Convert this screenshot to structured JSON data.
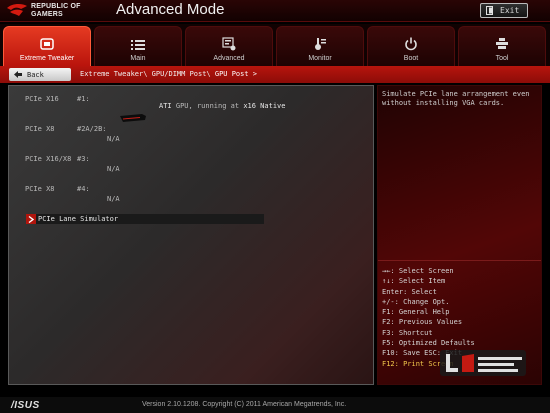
{
  "header": {
    "brand_line1": "REPUBLIC OF",
    "brand_line2": "GAMERS",
    "mode_title": "Advanced Mode",
    "exit_label": "Exit"
  },
  "tabs": [
    {
      "label": "Extreme Tweaker",
      "icon": "tweaker-icon",
      "active": true
    },
    {
      "label": "Main",
      "icon": "list-icon",
      "active": false
    },
    {
      "label": "Advanced",
      "icon": "advanced-icon",
      "active": false
    },
    {
      "label": "Monitor",
      "icon": "monitor-icon",
      "active": false
    },
    {
      "label": "Boot",
      "icon": "power-icon",
      "active": false
    },
    {
      "label": "Tool",
      "icon": "tool-icon",
      "active": false
    }
  ],
  "breadcrumb": {
    "back_label": "Back",
    "path": "Extreme Tweaker\\ GPU/DIMM Post\\ ",
    "current": "GPU Post >"
  },
  "slots": [
    {
      "name": "PCIe X16",
      "id": "#1:",
      "info_prefix": "ATI",
      "info_rest": " GPU, running at ",
      "info_speed": "x16 Native"
    },
    {
      "name": "PCIe X8",
      "id": "#2A/2B:",
      "value": "N/A"
    },
    {
      "name": "PCIe X16/X8",
      "id": "#3:",
      "value": "N/A"
    },
    {
      "name": "PCIe X8",
      "id": "#4:",
      "value": "N/A"
    }
  ],
  "menu_item": {
    "label": "PCIe Lane Simulator"
  },
  "help_text": "Simulate PCIe lane arrangement even without installing VGA cards.",
  "key_help": [
    "→←: Select Screen",
    "↑↓: Select Item",
    "Enter: Select",
    "+/-: Change Opt.",
    "F1: General Help",
    "F2: Previous Values",
    "F3: Shortcut",
    "F5: Optimized Defaults",
    "F10: Save  ESC: Exit",
    "F12: Print Screen"
  ],
  "footer": {
    "brand": "/ISUS",
    "version": "Version 2.10.1208. Copyright (C) 2011 American Megatrends, Inc."
  },
  "colors": {
    "accent_red": "#b9140c",
    "highlight_yellow": "#f2c84b"
  }
}
